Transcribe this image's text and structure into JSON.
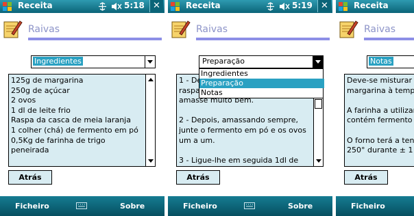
{
  "titlebar": {
    "title": "Receita"
  },
  "screens": [
    {
      "clock": "5:18",
      "heading": "Raivas",
      "dropdown_value": "Ingredientes",
      "text": "125g de margarina\n250g de açúcar\n2 ovos\n1 dl de leite frio\nRaspa da casca de meia laranja\n1 colher (chá) de fermento em pó\n0,5Kg de farinha de trigo peneirada",
      "back_label": "Atrás",
      "softkey_left": "Ficheiro",
      "softkey_right": "Sobre"
    },
    {
      "clock": "5:19",
      "heading": "Raivas",
      "dropdown_value": "Preparação",
      "text": "1 - De\nraspa\namasse muito bem.\n\n2 - Depois, amassando sempre,\njunte o fermento em pó e os ovos\num a um.\n\n3 - Ligue-lhe em seguida 1dl de",
      "back_label": "Atrás",
      "softkey_left": "Ficheiro",
      "softkey_right": "Sobre",
      "dropdown_options": [
        "Ingredientes",
        "Preparação",
        "Notas"
      ],
      "selected_option": "Preparação"
    },
    {
      "heading": "Raivas",
      "dropdown_value": "Notas",
      "text": "Deve-se misturar\nmargarina à tempe\n\nA farinha a utilizar\ncontém fermento\n\nO forno terá a ten\n250° durante ± 1",
      "back_label": "Atrás",
      "softkey_left": "Ficheiro"
    }
  ],
  "colors": {
    "titlebar": "#0b6478",
    "accent_rule": "#8d8fe6",
    "textbox_bg": "#d8ecf2",
    "selection": "#2aa1c2",
    "heading": "#8c93c8"
  },
  "icons": [
    "windows-start-icon",
    "connectivity-icon",
    "volume-icon",
    "close-icon",
    "recipe-notepad-icon",
    "keyboard-icon"
  ]
}
